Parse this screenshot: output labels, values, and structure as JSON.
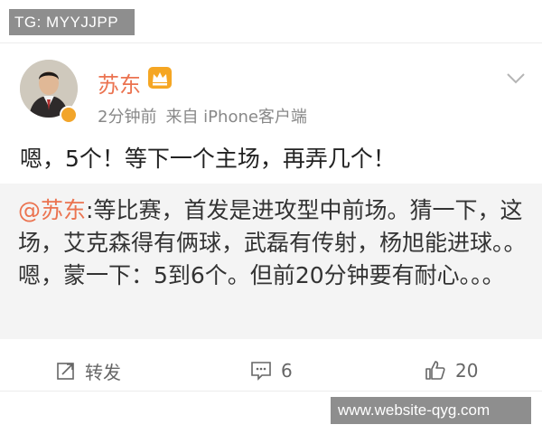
{
  "watermark_top": "TG: MYYJJPP",
  "watermark_bottom": "www.website-qyg.com",
  "post": {
    "author": "苏东",
    "time": "2分钟前",
    "source": "来自 iPhone客户端",
    "text": "嗯，5个！等下一个主场，再弄几个！",
    "icons": [
      "avatar",
      "verified-badge",
      "crown-icon",
      "chevron-down-icon"
    ]
  },
  "quoted": {
    "mention": "@苏东",
    "text": ":等比赛，首发是进攻型中前场。猜一下，这场，艾克森得有俩球，武磊有传射，杨旭能进球。。嗯，蒙一下：5到6个。但前20分钟要有耐心。。。"
  },
  "actions": {
    "repost_label": "转发",
    "comment_count": "6",
    "like_count": "20"
  },
  "colors": {
    "accent": "#eb7350",
    "quote_bg": "#f4f4f4",
    "meta": "#888888"
  }
}
